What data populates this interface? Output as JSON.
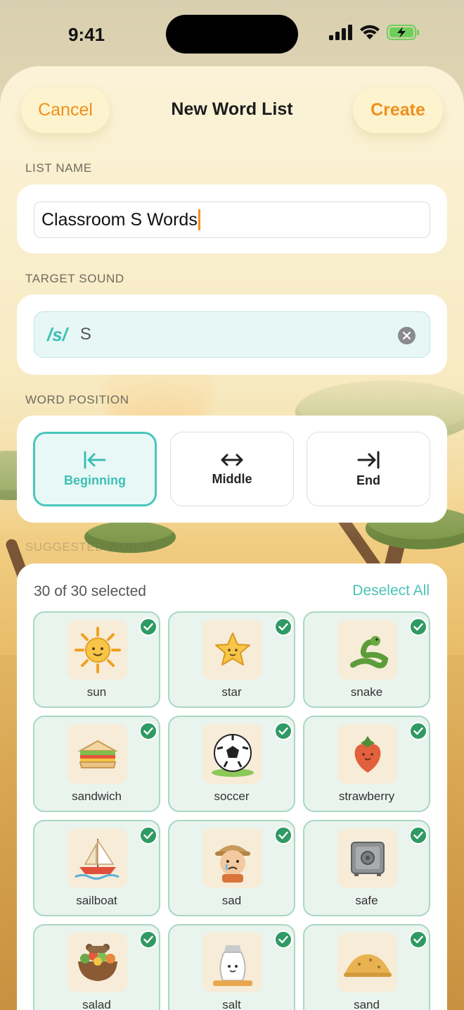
{
  "status": {
    "time": "9:41"
  },
  "header": {
    "cancel_label": "Cancel",
    "title": "New Word List",
    "create_label": "Create"
  },
  "list_name": {
    "label": "LIST NAME",
    "value": "Classroom S Words"
  },
  "target_sound": {
    "label": "TARGET SOUND",
    "phoneme": "/s/",
    "value": "S"
  },
  "word_position": {
    "label": "WORD POSITION",
    "options": [
      {
        "label": "Beginning",
        "icon": "arrow-left-to-bar-icon",
        "selected": true
      },
      {
        "label": "Middle",
        "icon": "arrow-left-right-icon",
        "selected": false
      },
      {
        "label": "End",
        "icon": "arrow-right-to-bar-icon",
        "selected": false
      }
    ]
  },
  "suggested": {
    "label": "SUGGESTED WORDS",
    "count_text": "30 of 30 selected",
    "deselect_label": "Deselect All",
    "words": [
      {
        "label": "sun",
        "icon": "sun-icon",
        "selected": true
      },
      {
        "label": "star",
        "icon": "star-icon",
        "selected": true
      },
      {
        "label": "snake",
        "icon": "snake-icon",
        "selected": true
      },
      {
        "label": "sandwich",
        "icon": "sandwich-icon",
        "selected": true
      },
      {
        "label": "soccer",
        "icon": "soccer-ball-icon",
        "selected": true
      },
      {
        "label": "strawberry",
        "icon": "strawberry-icon",
        "selected": true
      },
      {
        "label": "sailboat",
        "icon": "sailboat-icon",
        "selected": true
      },
      {
        "label": "sad",
        "icon": "sad-face-icon",
        "selected": true
      },
      {
        "label": "safe",
        "icon": "safe-icon",
        "selected": true
      },
      {
        "label": "salad",
        "icon": "salad-icon",
        "selected": true
      },
      {
        "label": "salt",
        "icon": "salt-shaker-icon",
        "selected": true
      },
      {
        "label": "sand",
        "icon": "sand-icon",
        "selected": true
      }
    ]
  },
  "colors": {
    "accent_orange": "#f0901c",
    "accent_teal": "#3bbfb3",
    "check_green": "#2f9a63"
  }
}
